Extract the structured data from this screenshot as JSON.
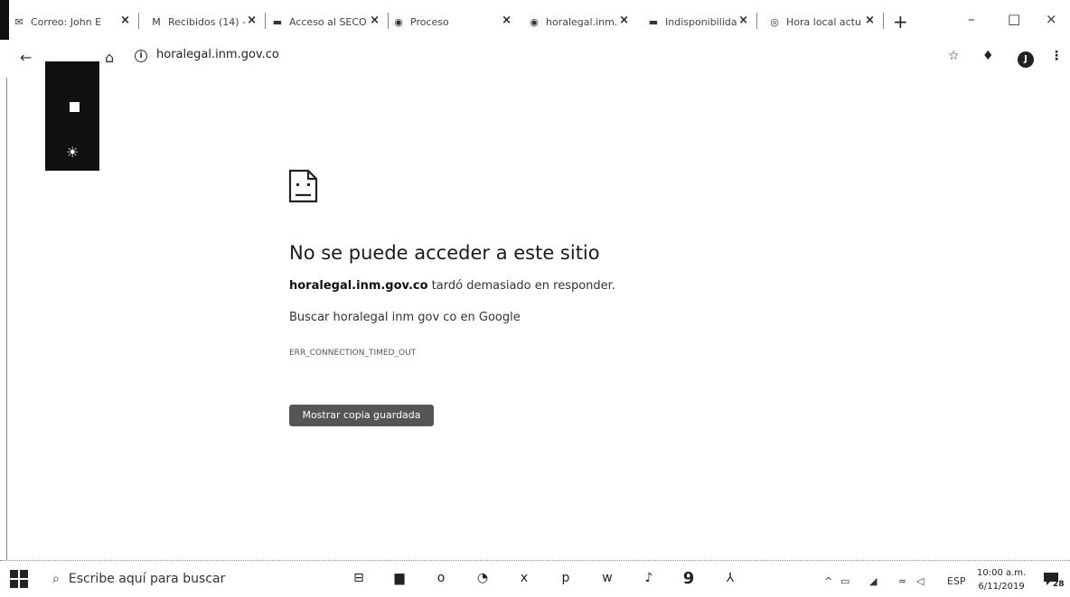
{
  "tabs": [
    {
      "icon": "outlook-icon",
      "glyph": "✉",
      "label": "Correo: John E"
    },
    {
      "icon": "gmail-icon",
      "glyph": "M",
      "label": "Recibidos (14) -"
    },
    {
      "icon": "secop-icon",
      "glyph": "▬",
      "label": "Acceso al SECO"
    },
    {
      "icon": "globe-icon",
      "glyph": "◉",
      "label": "Proceso"
    },
    {
      "icon": "globe-icon",
      "glyph": "◉",
      "label": "horalegal.inm."
    },
    {
      "icon": "secop-icon",
      "glyph": "▬",
      "label": "Indisponibilida"
    },
    {
      "icon": "clock-globe-icon",
      "glyph": "◎",
      "label": "Hora local actu"
    }
  ],
  "tab_close": "×",
  "new_tab": "+",
  "window": {
    "minimize": "–",
    "maximize": "□",
    "close": "×"
  },
  "nav": {
    "back": "←",
    "home": "⌂"
  },
  "address": {
    "info": "i",
    "url": "horalegal.inm.gov.co"
  },
  "toolbar_right": {
    "star": "☆",
    "extension": "♦",
    "avatar": "J",
    "menu": "⋮"
  },
  "overlay": {
    "sun": "☀"
  },
  "error": {
    "title": "No se puede acceder a este sitio",
    "host": "horalegal.inm.gov.co",
    "detail": " tardó demasiado en responder.",
    "search_text": "Buscar horalegal inm gov co en Google",
    "code": "ERR_CONNECTION_TIMED_OUT",
    "button": "Mostrar copia guardada"
  },
  "taskbar": {
    "search_placeholder": "Escribe aquí para buscar",
    "apps": [
      {
        "icon": "task-view-icon",
        "glyph": "⊟"
      },
      {
        "icon": "file-explorer-icon",
        "glyph": "▆"
      },
      {
        "icon": "outlook-app-icon",
        "glyph": "o"
      },
      {
        "icon": "chrome-app-icon",
        "glyph": "◔"
      },
      {
        "icon": "excel-icon",
        "glyph": "x"
      },
      {
        "icon": "powerpoint-icon",
        "glyph": "p"
      },
      {
        "icon": "word-icon",
        "glyph": "w"
      },
      {
        "icon": "media-app-icon",
        "glyph": "♪"
      },
      {
        "icon": "app-9-icon",
        "glyph": "9"
      },
      {
        "icon": "acrobat-icon",
        "glyph": "⅄"
      }
    ],
    "tray": {
      "chevron": "^",
      "language": "ESP"
    },
    "clock": {
      "time": "10:00 a.m.",
      "date": "6/11/2019"
    },
    "notifications": "28"
  }
}
